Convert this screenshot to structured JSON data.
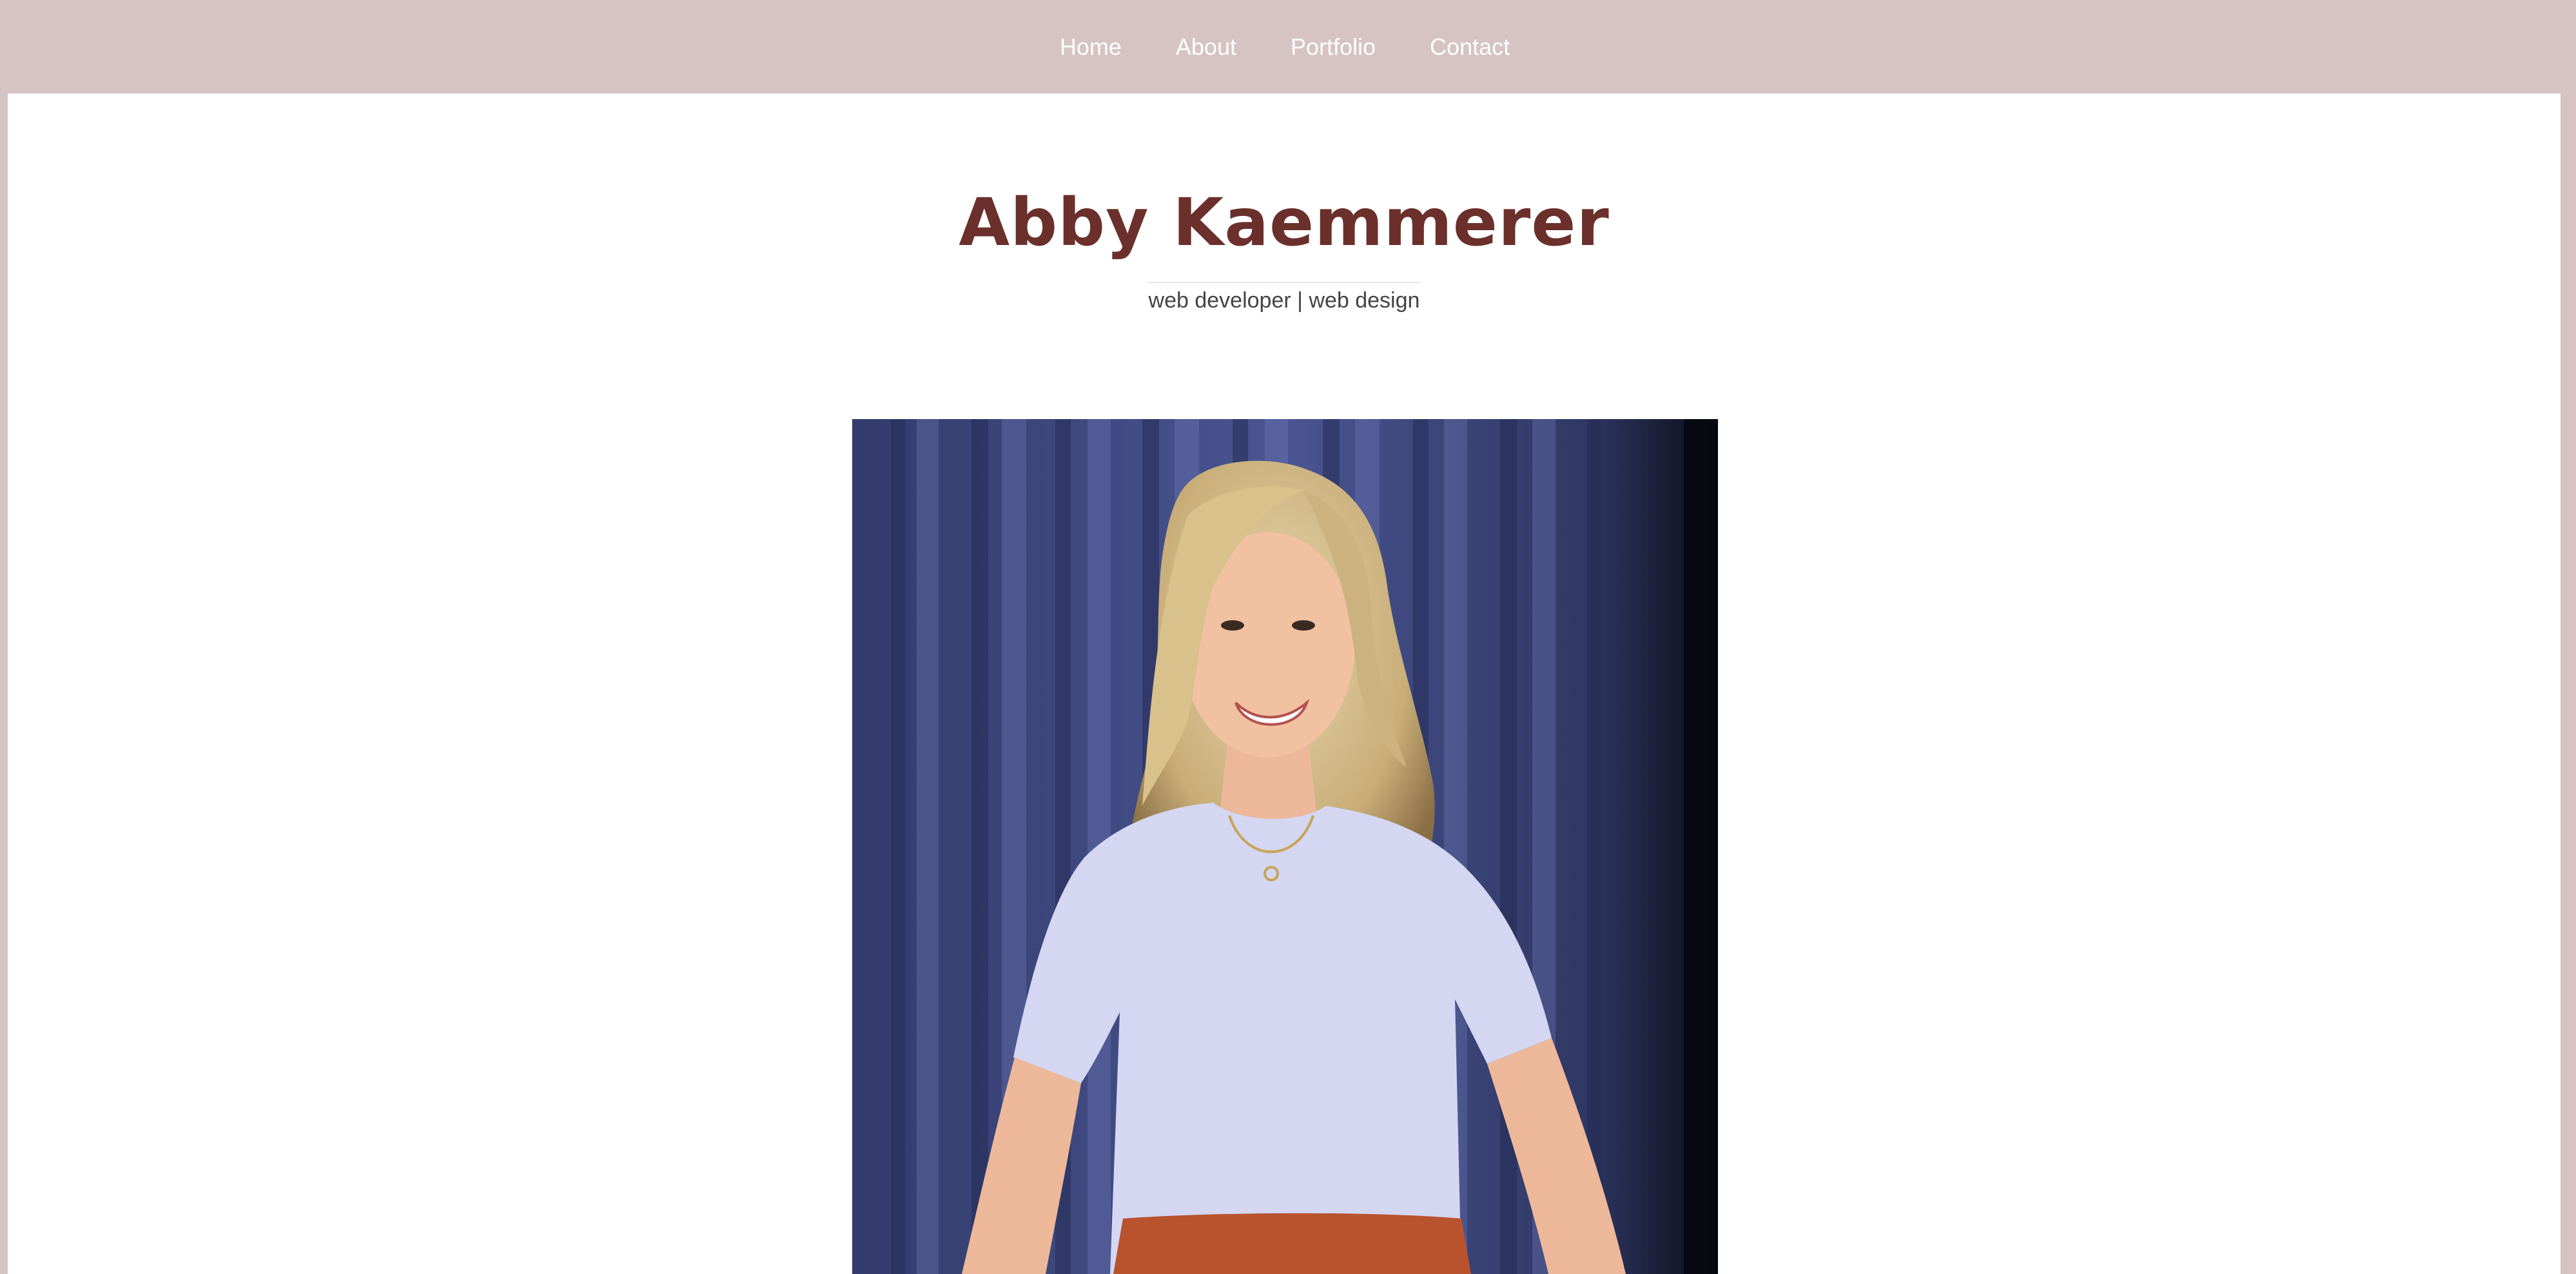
{
  "nav": {
    "items": [
      {
        "label": "Home"
      },
      {
        "label": "About"
      },
      {
        "label": "Portfolio"
      },
      {
        "label": "Contact"
      }
    ]
  },
  "hero": {
    "name": "Abby Kaemmerer",
    "tagline": "web developer | web design"
  },
  "colors": {
    "nav_bg": "#d6c4c5",
    "name": "#6b302b",
    "wall": "#3c4678",
    "shirt": "#d4d6f2",
    "skirt": "#b8532e"
  },
  "photo": {
    "subject": "portrait-photo"
  }
}
